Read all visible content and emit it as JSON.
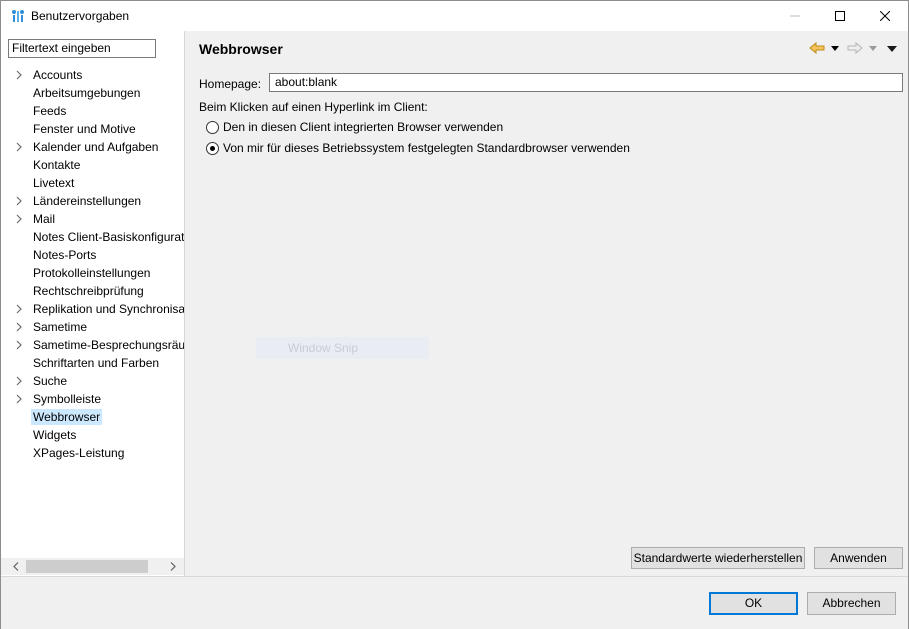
{
  "window": {
    "title": "Benutzervorgaben",
    "controls": {
      "minimize": "minimize-icon",
      "maximize": "maximize-icon",
      "close": "close-icon"
    }
  },
  "sidebar": {
    "filter_placeholder": "Filtertext eingeben",
    "items": [
      {
        "label": "Accounts",
        "expandable": true
      },
      {
        "label": "Arbeitsumgebungen",
        "expandable": false
      },
      {
        "label": "Feeds",
        "expandable": false
      },
      {
        "label": "Fenster und Motive",
        "expandable": false
      },
      {
        "label": "Kalender und Aufgaben",
        "expandable": true
      },
      {
        "label": "Kontakte",
        "expandable": false
      },
      {
        "label": "Livetext",
        "expandable": false
      },
      {
        "label": "Ländereinstellungen",
        "expandable": true
      },
      {
        "label": "Mail",
        "expandable": true
      },
      {
        "label": "Notes Client-Basiskonfigurat",
        "expandable": false
      },
      {
        "label": "Notes-Ports",
        "expandable": false
      },
      {
        "label": "Protokolleinstellungen",
        "expandable": false
      },
      {
        "label": "Rechtschreibprüfung",
        "expandable": false
      },
      {
        "label": "Replikation und Synchronisa",
        "expandable": true
      },
      {
        "label": "Sametime",
        "expandable": true
      },
      {
        "label": "Sametime-Besprechungsräu",
        "expandable": true
      },
      {
        "label": "Schriftarten und Farben",
        "expandable": false
      },
      {
        "label": "Suche",
        "expandable": true
      },
      {
        "label": "Symbolleiste",
        "expandable": true
      },
      {
        "label": "Webbrowser",
        "expandable": false,
        "selected": true
      },
      {
        "label": "Widgets",
        "expandable": false
      },
      {
        "label": "XPages-Leistung",
        "expandable": false
      }
    ]
  },
  "main": {
    "title": "Webbrowser",
    "homepage_label": "Homepage:",
    "homepage_value": "about:blank",
    "click_label": "Beim Klicken auf einen Hyperlink im Client:",
    "radio_options": [
      {
        "label": "Den in diesen Client integrierten Browser verwenden",
        "checked": false
      },
      {
        "label": "Von mir für dieses Betriebssystem festgelegten Standardbrowser verwenden",
        "checked": true
      }
    ],
    "restore_defaults_label": "Standardwerte wiederherstellen",
    "apply_label": "Anwenden"
  },
  "overlay": {
    "text": "Window Snip"
  },
  "footer": {
    "ok_label": "OK",
    "cancel_label": "Abbrechen"
  },
  "colors": {
    "selection": "#cce8ff",
    "pane_bg": "#f0f0f0",
    "primary_border": "#0078d7",
    "nav_back": "#e8a92a"
  }
}
